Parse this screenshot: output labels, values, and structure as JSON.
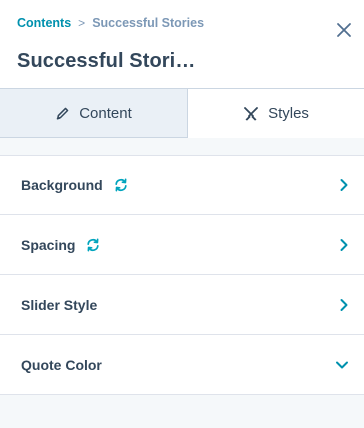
{
  "breadcrumb": {
    "parent": "Contents",
    "separator": ">",
    "current": "Successful Stories"
  },
  "header": {
    "title": "Successful Stori…",
    "close_icon": "close-icon"
  },
  "tabs": [
    {
      "label": "Content",
      "icon": "pencil-icon",
      "active": false
    },
    {
      "label": "Styles",
      "icon": "crossed-brushes-icon",
      "active": true
    }
  ],
  "sections": [
    {
      "label": "Background",
      "synced": true,
      "state": "collapsed"
    },
    {
      "label": "Spacing",
      "synced": true,
      "state": "collapsed"
    },
    {
      "label": "Slider Style",
      "synced": false,
      "state": "collapsed"
    },
    {
      "label": "Quote Color",
      "synced": false,
      "state": "expanded"
    }
  ],
  "colors": {
    "accent": "#0091ae",
    "text": "#33475b",
    "muted": "#7c98b6",
    "tab_inactive_bg": "#eaf0f6",
    "panel_bg": "#f5f8fa"
  }
}
